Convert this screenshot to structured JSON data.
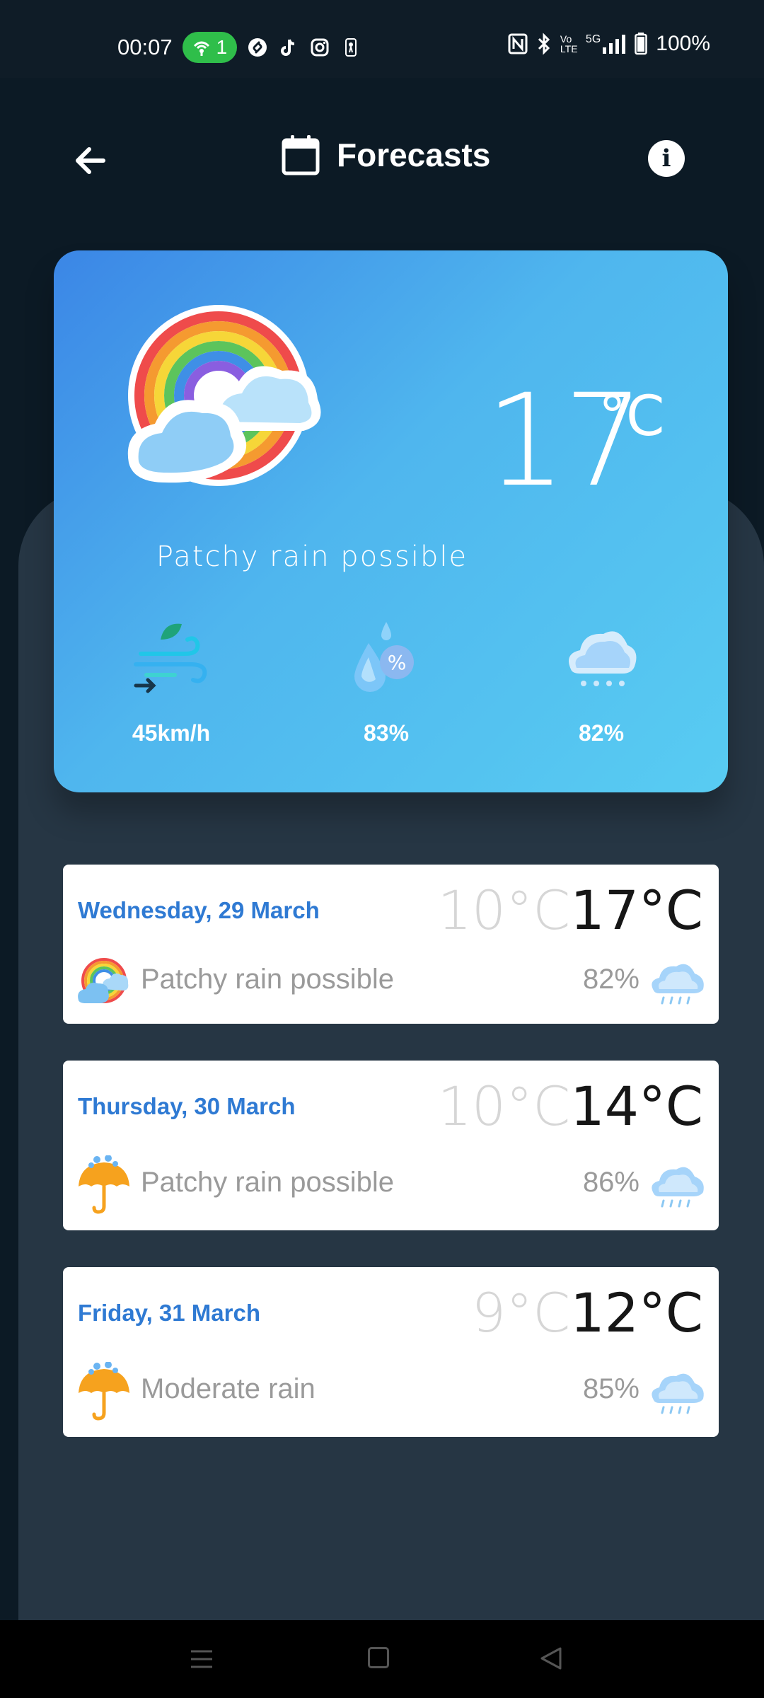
{
  "status_bar": {
    "time": "00:07",
    "hotspot_count": "1",
    "battery": "100%",
    "network": "5G",
    "volte": "Vo LTE",
    "icons": [
      "hotspot-icon",
      "shazam-icon",
      "tiktok-icon",
      "instagram-icon",
      "nba-icon",
      "nfc-icon",
      "bluetooth-icon",
      "volte-icon",
      "signal-icon",
      "battery-icon"
    ]
  },
  "header": {
    "title": "Forecasts",
    "icons": [
      "back-arrow-icon",
      "calendar-icon",
      "info-icon"
    ]
  },
  "current": {
    "temperature": "17",
    "unit": "°C",
    "condition": "Patchy rain possible",
    "icon": "rainbow-cloud-icon",
    "wind": "45km/h",
    "humidity": "83%",
    "cloud": "82%",
    "stat_icons": [
      "wind-icon",
      "humidity-icon",
      "cloud-rain-icon"
    ]
  },
  "forecast": [
    {
      "date": "Wednesday, 29 March",
      "min": "10°C",
      "max": "17°C",
      "condition": "Patchy rain possible",
      "percent": "82%",
      "icon": "rainbow-cloud-icon"
    },
    {
      "date": "Thursday, 30 March",
      "min": "10°C",
      "max": "14°C",
      "condition": "Patchy rain possible",
      "percent": "86%",
      "icon": "umbrella-rain-icon"
    },
    {
      "date": "Friday, 31 March",
      "min": "9°C",
      "max": "12°C",
      "condition": "Moderate rain",
      "percent": "85%",
      "icon": "umbrella-rain-icon"
    }
  ],
  "colors": {
    "background": "#0c1a25",
    "panel": "#263644",
    "card_gradient_start": "#3b86e6",
    "card_gradient_end": "#58ccf2",
    "date_blue": "#2f7ad3",
    "hotspot_green": "#2fbe4a"
  }
}
